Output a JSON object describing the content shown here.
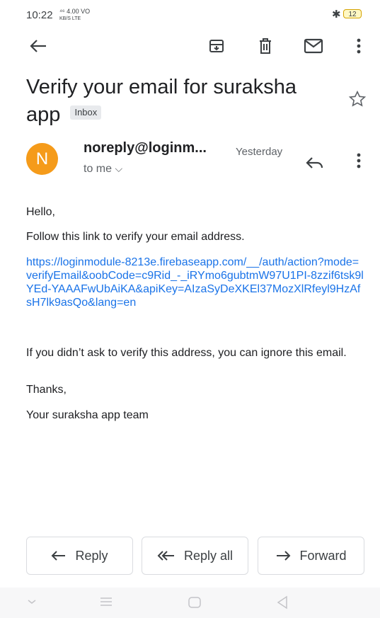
{
  "status": {
    "time": "10:22",
    "signal": "⁴⁶ 4.00 VO",
    "signal_sub": "KB/S LTE",
    "battery": "12"
  },
  "toolbar": {
    "back": "back-arrow-icon",
    "archive": "archive-icon",
    "delete": "trash-icon",
    "mark_unread": "envelope-icon",
    "more": "more-vert-icon"
  },
  "email": {
    "subject": "Verify your email for suraksha app",
    "label": "Inbox",
    "avatar_letter": "N",
    "avatar_color": "#f59b1a",
    "sender": "noreply@loginm...",
    "date": "Yesterday",
    "recipient": "to me",
    "greeting": "Hello,",
    "line1": "Follow this link to verify your email address.",
    "link": "https://loginmodule-8213e.firebaseapp.com/__/auth/action?mode=verifyEmail&oobCode=c9Rid_-_iRYmo6gubtmW97U1PI-8zzif6tsk9lYEd-YAAAFwUbAiKA&apiKey=AIzaSyDeXKEl37MozXlRfeyl9HzAfsH7lk9asQo&lang=en",
    "line2": "If you didn’t ask to verify this address, you can ignore this email.",
    "closing": "Thanks,",
    "signature": "Your suraksha app team"
  },
  "actions": {
    "reply": "Reply",
    "reply_all": "Reply all",
    "forward": "Forward"
  },
  "accent": "#1a73e8"
}
